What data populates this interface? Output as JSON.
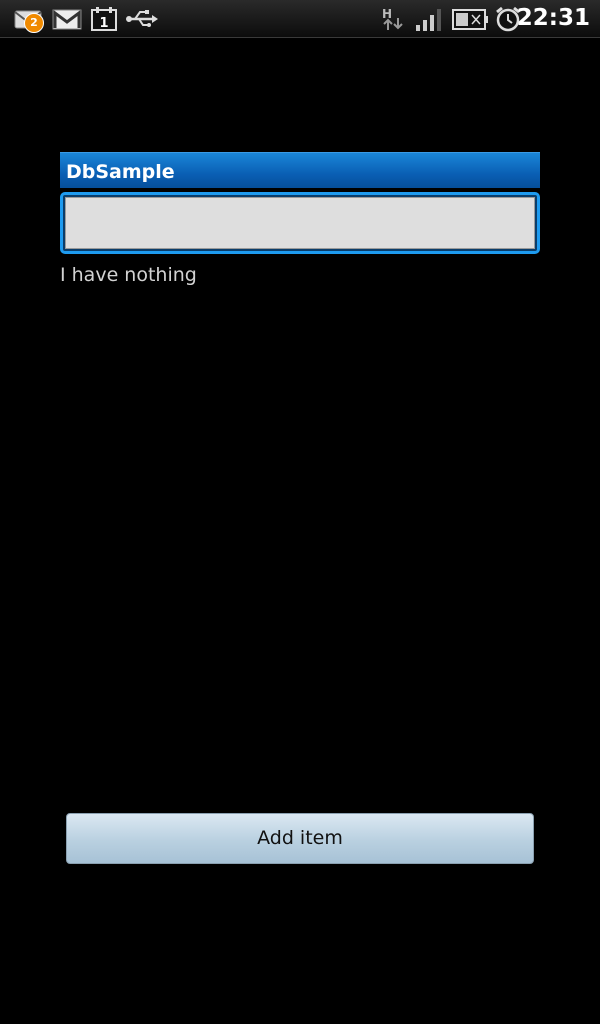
{
  "status_bar": {
    "mail_badge_count": "2",
    "time": "22:31",
    "icons": [
      "email-icon",
      "gmail-icon",
      "calendar-icon",
      "usb-icon",
      "hspa-data-icon",
      "signal-icon",
      "battery-icon",
      "alarm-icon"
    ],
    "calendar_day": "1",
    "network_label": "H"
  },
  "app": {
    "title": "DbSample",
    "input_value": "",
    "empty_text": "I have nothing",
    "add_button_label": "Add item"
  },
  "colors": {
    "title_bar": "#0a5fb4",
    "focus_border": "#1e9bf0",
    "badge": "#f08a00"
  }
}
